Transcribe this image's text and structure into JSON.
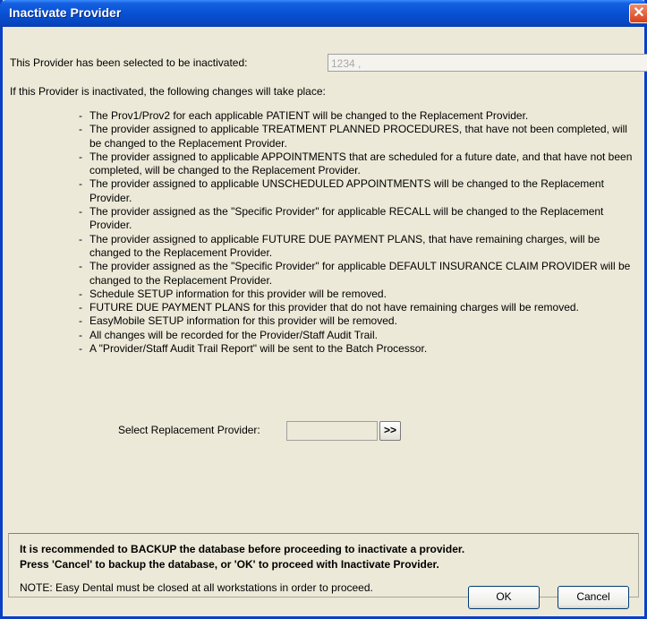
{
  "window": {
    "title": "Inactivate Provider",
    "close_glyph": "✕"
  },
  "selected": {
    "label": "This Provider has been selected to be inactivated:",
    "value": "1234 ,"
  },
  "intro": "If this Provider is inactivated, the following changes will take place:",
  "changes": [
    "The Prov1/Prov2 for each applicable PATIENT will be changed to the Replacement Provider.",
    "The provider assigned to applicable TREATMENT PLANNED PROCEDURES, that have not been completed, will be changed to the Replacement Provider.",
    "The provider assigned to applicable APPOINTMENTS that are scheduled for a future date, and that have not been completed, will be changed to the Replacement Provider.",
    "The provider assigned to applicable UNSCHEDULED APPOINTMENTS will be changed to the Replacement Provider.",
    "The provider assigned as the \"Specific Provider\" for applicable RECALL will be changed to the Replacement Provider.",
    "The provider assigned to applicable FUTURE DUE PAYMENT PLANS, that have remaining charges, will be changed to the Replacement Provider.",
    "The provider assigned as the \"Specific Provider\" for applicable DEFAULT INSURANCE CLAIM PROVIDER will be changed to the Replacement Provider.",
    "Schedule SETUP information for this provider will be removed.",
    "FUTURE DUE PAYMENT PLANS for this provider that do not have remaining charges will be removed.",
    "EasyMobile SETUP information for this provider will be removed.",
    "All changes will be recorded for the Provider/Staff Audit Trail.",
    "A \"Provider/Staff Audit Trail Report\" will be sent to the Batch Processor."
  ],
  "replacement": {
    "label": "Select Replacement Provider:",
    "value": "",
    "button_label": ">>"
  },
  "warning": {
    "line1": "It is recommended to BACKUP the database before proceeding to inactivate a provider.",
    "line2": "Press 'Cancel' to backup the database, or 'OK' to proceed with Inactivate Provider.",
    "note": "NOTE: Easy Dental must be closed at all workstations in order to proceed."
  },
  "buttons": {
    "ok": "OK",
    "cancel": "Cancel"
  }
}
